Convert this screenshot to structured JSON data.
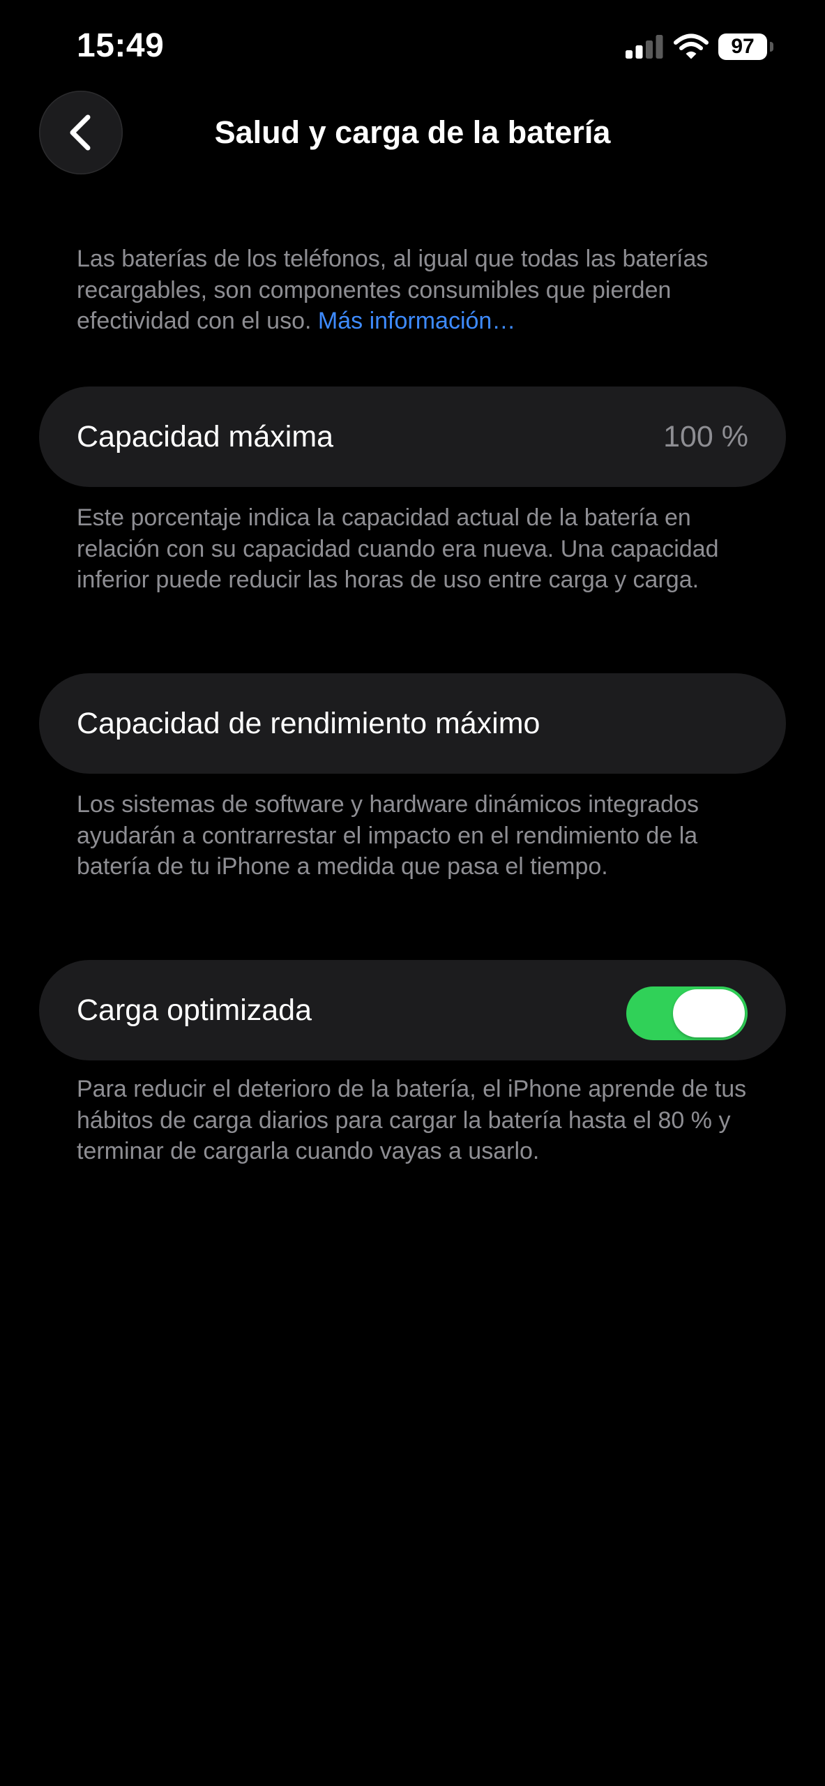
{
  "status_bar": {
    "time": "15:49",
    "signal_icon": "cellular-signal-icon",
    "wifi_icon": "wifi-icon",
    "battery_level": "97"
  },
  "nav": {
    "back_icon": "chevron-left-icon",
    "title": "Salud y carga de la batería"
  },
  "intro": {
    "text": "Las baterías de los teléfonos, al igual que todas las baterías recargables, son componentes consumibles que pierden efectividad con el uso. ",
    "link": "Más información…"
  },
  "max_capacity": {
    "label": "Capacidad máxima",
    "value": "100 %",
    "footnote": "Este porcentaje indica la capacidad actual de la batería en relación con su capacidad cuando era nueva. Una capacidad inferior puede reducir las horas de uso entre carga y carga."
  },
  "peak_performance": {
    "label": "Capacidad de rendimiento máximo",
    "footnote": "Los sistemas de software y hardware dinámicos integrados ayudarán a contrarrestar el impacto en el rendimiento de la batería de tu iPhone a medida que pasa el tiempo."
  },
  "optimized_charging": {
    "label": "Carga optimizada",
    "enabled": true,
    "footnote": "Para reducir el deterioro de la batería, el iPhone aprende de tus hábitos de carga diarios para cargar la batería hasta el 80 % y terminar de cargarla cuando vayas a usarlo."
  },
  "colors": {
    "background": "#000000",
    "cell_background": "#1c1c1e",
    "secondary_text": "#8e8e93",
    "link": "#3e8bff",
    "toggle_on": "#30d158"
  }
}
